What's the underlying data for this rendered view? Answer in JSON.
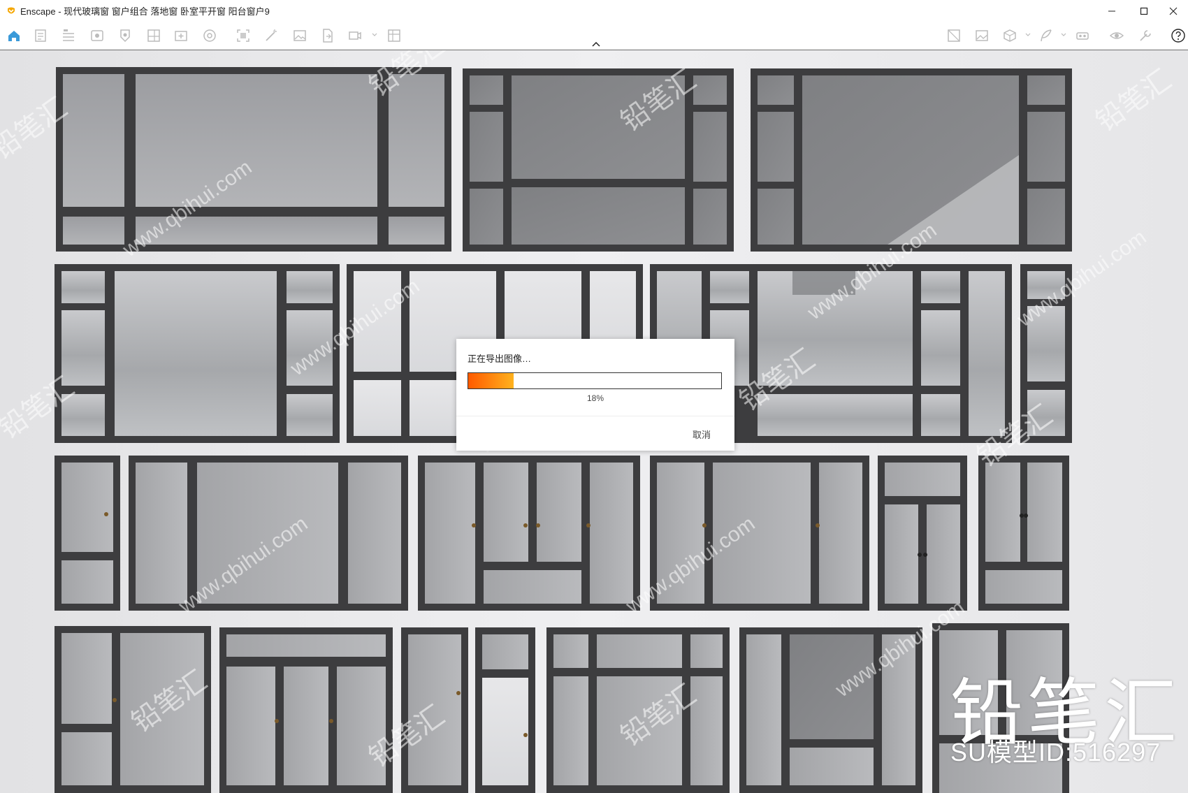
{
  "window": {
    "title": "Enscape - 现代玻璃窗 窗户组合 落地窗 卧室平开窗 阳台窗户9"
  },
  "toolbar": {
    "icons": [
      "home-icon",
      "export-doc-icon",
      "bim-icon",
      "visibility-icon",
      "settings-icon",
      "views-icon",
      "add-view-icon",
      "render-icon",
      "screenshot-icon",
      "magic-icon",
      "image-icon",
      "export-file-icon",
      "video-icon",
      "batch-icon",
      "asset-library-icon",
      "image-gallery-icon",
      "material-cube-icon",
      "feather-icon",
      "vr-icon",
      "eye-icon",
      "tools-icon",
      "help-icon"
    ]
  },
  "dialog": {
    "title": "正在导出图像…",
    "percent_label": "18%",
    "progress": 0.18,
    "cancel_label": "取消"
  },
  "branding": {
    "logo_text": "铅笔汇",
    "model_id": "SU模型ID:516297",
    "watermark_texts": [
      "铅笔汇",
      "www.qbihui.com"
    ]
  },
  "colors": {
    "accent_orange": "#ff7a00",
    "frame_dark": "#3d3d3f",
    "glass": "#a9aaad",
    "wall": "#ebebed"
  }
}
